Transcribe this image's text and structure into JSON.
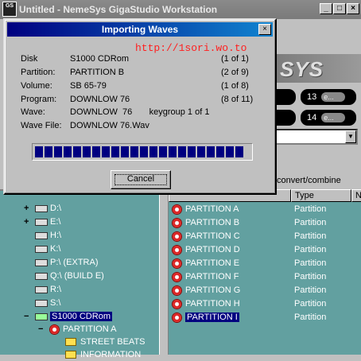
{
  "window": {
    "title": "Untitled - NemeSys GigaStudio Workstation",
    "icon_label": "GS"
  },
  "window_buttons": {
    "minimize": "_",
    "maximize": "□",
    "close": "×"
  },
  "logo": {
    "text": "SYS"
  },
  "bg_controls": {
    "pills": [
      {
        "number": "13",
        "chip": "e..."
      },
      {
        "number": "14",
        "chip": "e..."
      }
    ],
    "combo_arrow": "▼",
    "strip_label": "convert/combine"
  },
  "dialog": {
    "title": "Importing Waves",
    "url": "http://1sori.wo.to",
    "rows": [
      {
        "label": "Disk",
        "value": "S1000 CDRom",
        "count": "(1 of 1)"
      },
      {
        "label": "Partition:",
        "value": "PARTITION  B",
        "count": "(2 of 9)"
      },
      {
        "label": "Volume:",
        "value": "SB  65-79",
        "count": "(1 of 8)"
      },
      {
        "label": "Program:",
        "value": "DOWNLOW  76",
        "count": "(8 of 11)"
      },
      {
        "label": "Wave:",
        "value": "DOWNLOW  76       keygroup 1 of 1",
        "count": ""
      },
      {
        "label": "Wave File:",
        "value": "DOWNLOW 76.Wav",
        "count": ""
      }
    ],
    "progress_fraction": 0.98,
    "cancel_label": "Cancel",
    "close_glyph": "×"
  },
  "tree": {
    "items": [
      {
        "expander": "+",
        "label": "D:\\",
        "kind": "drive"
      },
      {
        "expander": "+",
        "label": "E:\\",
        "kind": "drive"
      },
      {
        "expander": "",
        "label": "H:\\",
        "kind": "drive"
      },
      {
        "expander": "",
        "label": "K:\\",
        "kind": "drive"
      },
      {
        "expander": "",
        "label": "P:\\ (EXTRA)",
        "kind": "drive"
      },
      {
        "expander": "",
        "label": "Q:\\ (BUILD E)",
        "kind": "drive"
      },
      {
        "expander": "",
        "label": "R:\\",
        "kind": "drive"
      },
      {
        "expander": "",
        "label": "S:\\",
        "kind": "drive"
      },
      {
        "expander": "−",
        "label": "S1000 CDRom",
        "kind": "drive-selected"
      },
      {
        "expander": "−",
        "label": "PARTITION  A",
        "kind": "disc"
      },
      {
        "expander": "",
        "label": "STREET BEATS",
        "kind": "folder"
      },
      {
        "expander": "",
        "label": "INFORMATION",
        "kind": "folder"
      }
    ]
  },
  "list": {
    "columns": [
      "",
      "Type",
      "N"
    ],
    "rows": [
      {
        "name": "PARTITION  A",
        "type": "Partition"
      },
      {
        "name": "PARTITION  B",
        "type": "Partition"
      },
      {
        "name": "PARTITION  C",
        "type": "Partition"
      },
      {
        "name": "PARTITION  D",
        "type": "Partition"
      },
      {
        "name": "PARTITION  E",
        "type": "Partition"
      },
      {
        "name": "PARTITION  F",
        "type": "Partition"
      },
      {
        "name": "PARTITION  G",
        "type": "Partition"
      },
      {
        "name": "PARTITION  H",
        "type": "Partition"
      },
      {
        "name": "PARTITION  I",
        "type": "Partition"
      }
    ]
  }
}
